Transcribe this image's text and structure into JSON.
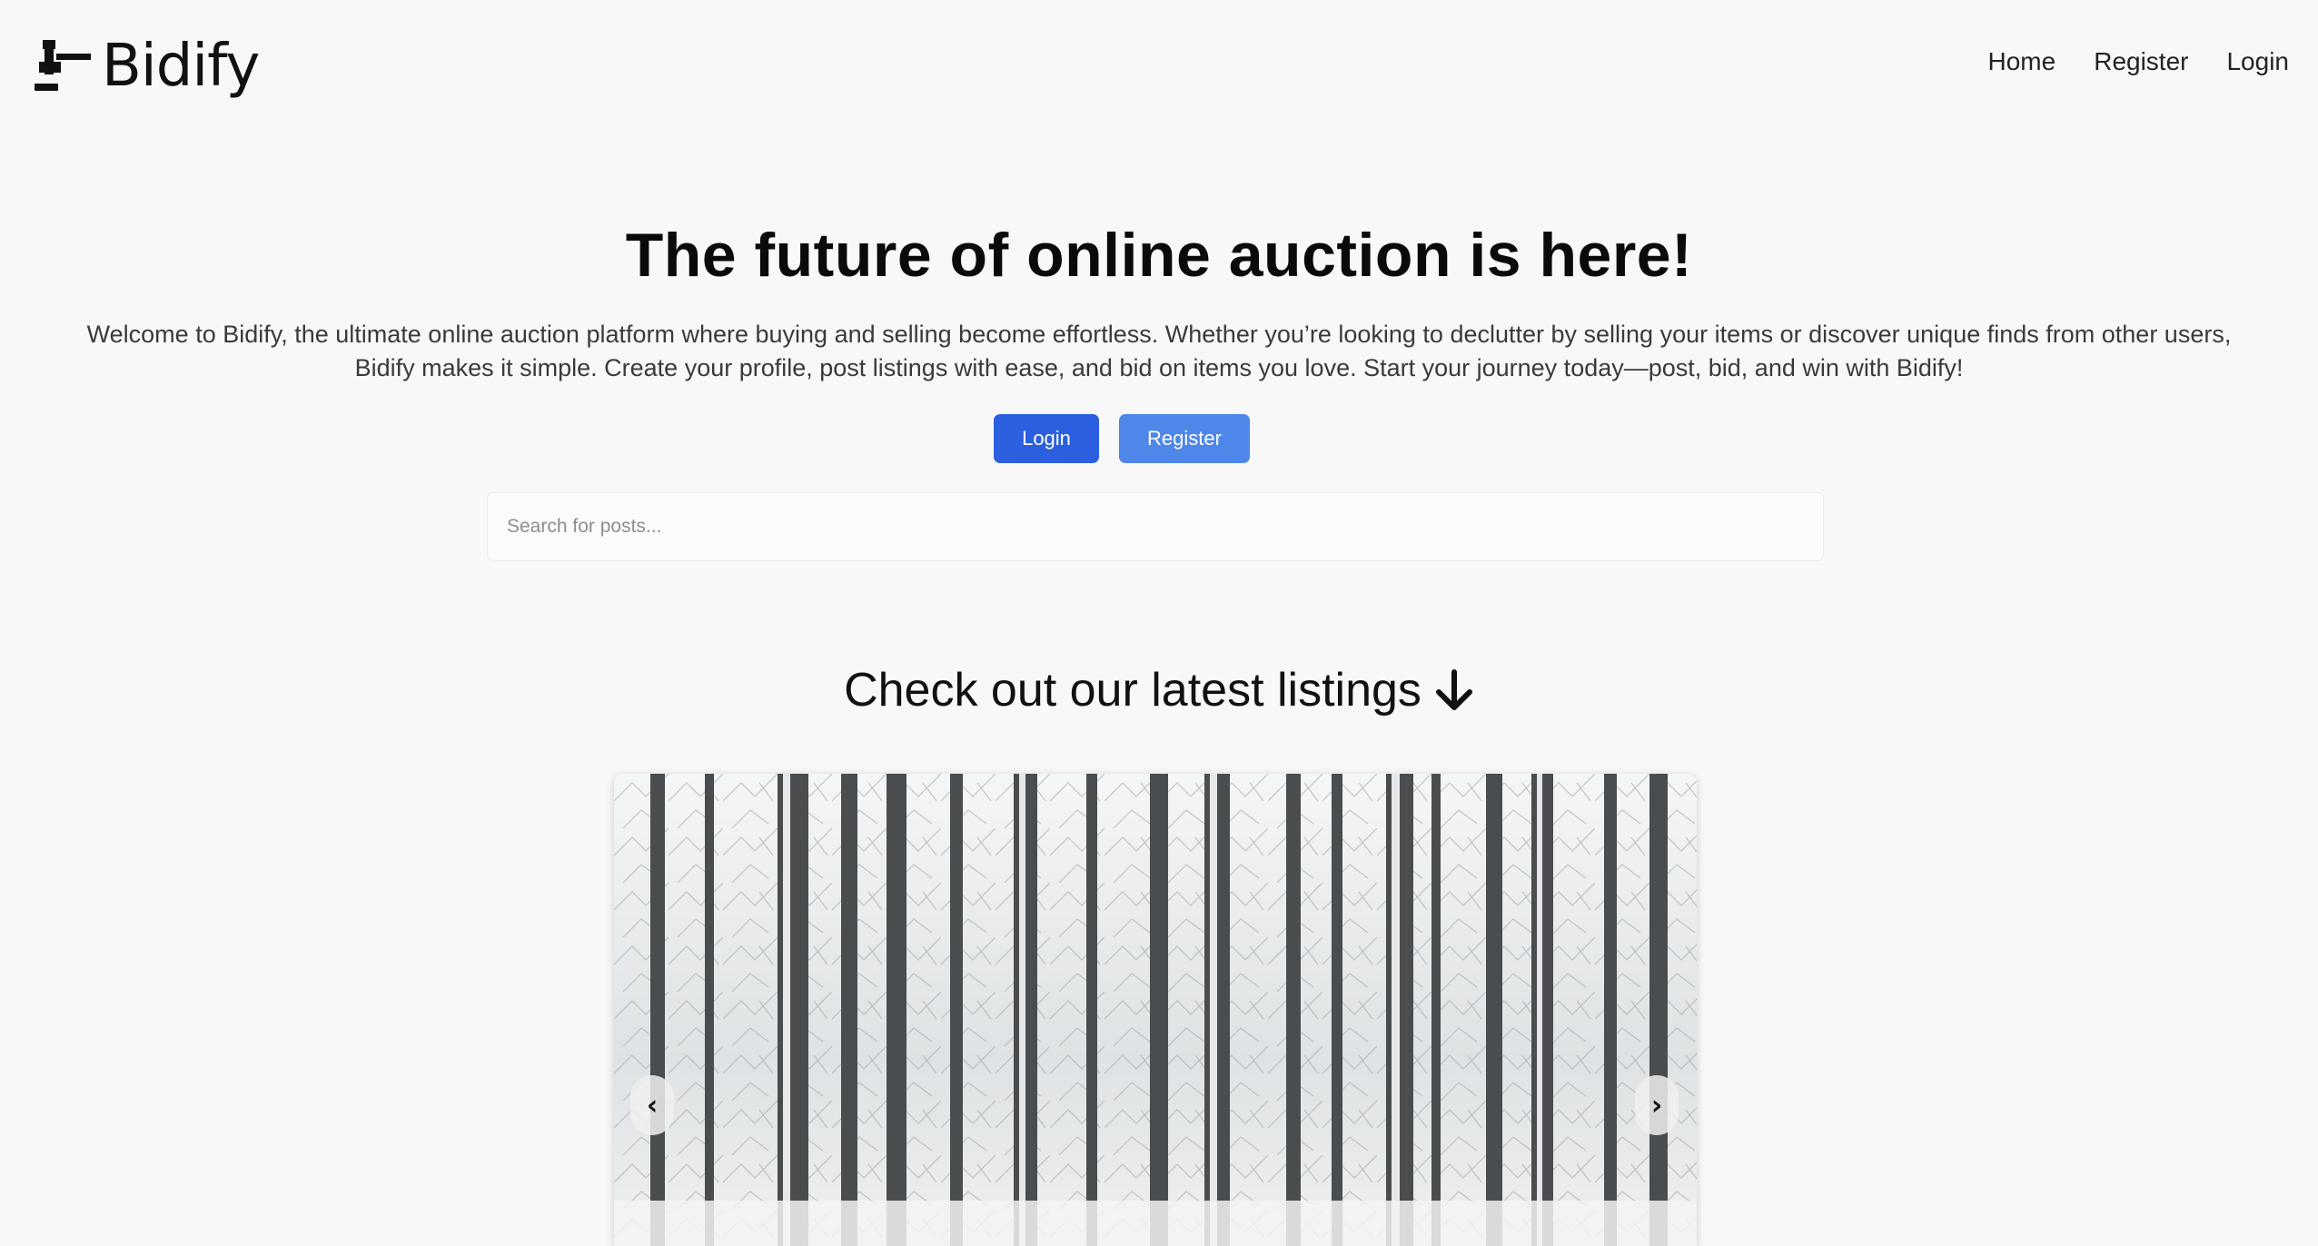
{
  "brand": {
    "name": "Bidify",
    "logo_icon": "gavel-icon"
  },
  "nav": {
    "items": [
      {
        "label": "Home"
      },
      {
        "label": "Register"
      },
      {
        "label": "Login"
      }
    ]
  },
  "hero": {
    "title": "The future of online auction is here!",
    "description": "Welcome to Bidify, the ultimate online auction platform where buying and selling become effortless. Whether you’re looking to declutter by selling your items or discover unique finds from other users, Bidify makes it simple. Create your profile, post listings with ease, and bid on items you love. Start your journey today—post, bid, and win with Bidify!",
    "login_label": "Login",
    "register_label": "Register"
  },
  "search": {
    "placeholder": "Search for posts...",
    "value": ""
  },
  "listings": {
    "title": "Check out our latest listings",
    "title_icon": "arrow-down-icon",
    "carousel": {
      "prev_label": "‹",
      "next_label": "›"
    }
  },
  "colors": {
    "login_button": "#2c5fe0",
    "register_button": "#4f86ea",
    "background": "#f9f8f8"
  }
}
